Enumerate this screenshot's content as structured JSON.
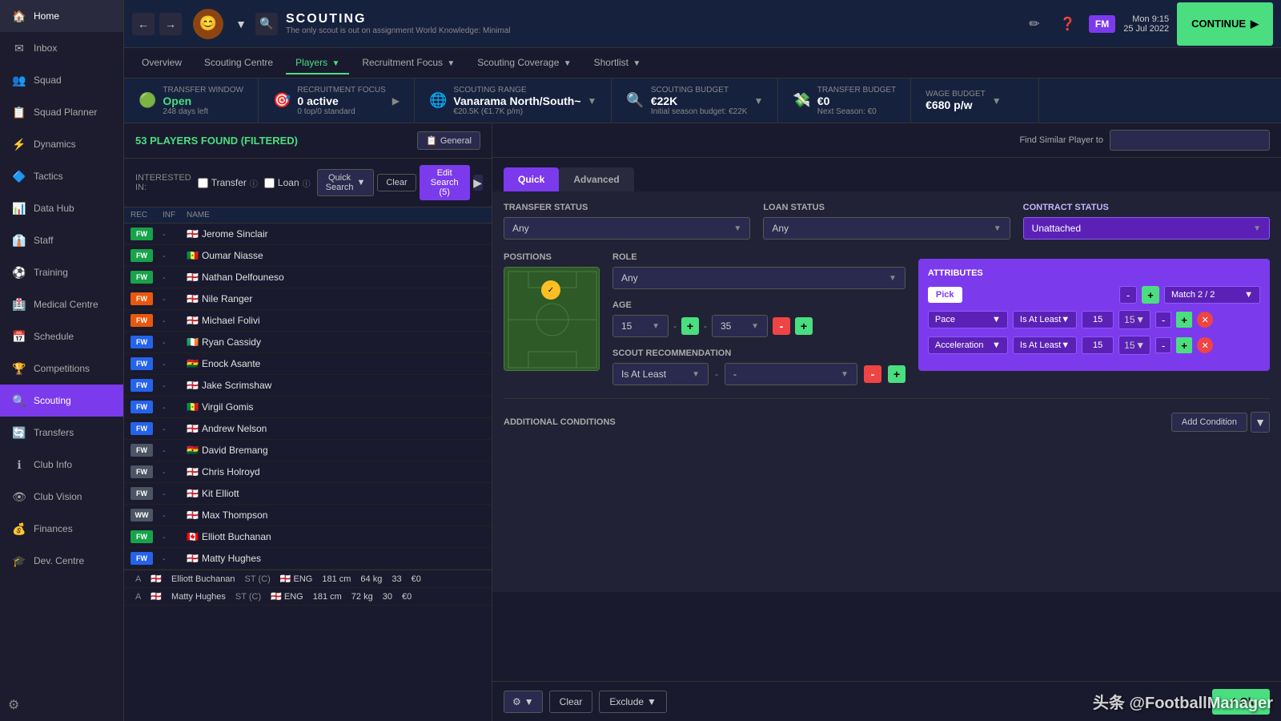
{
  "sidebar": {
    "items": [
      {
        "id": "home",
        "label": "Home",
        "icon": "🏠",
        "active": false
      },
      {
        "id": "inbox",
        "label": "Inbox",
        "icon": "✉",
        "active": false
      },
      {
        "id": "squad",
        "label": "Squad",
        "icon": "👥",
        "active": false
      },
      {
        "id": "squad-planner",
        "label": "Squad Planner",
        "icon": "📋",
        "active": false
      },
      {
        "id": "dynamics",
        "label": "Dynamics",
        "icon": "⚡",
        "active": false
      },
      {
        "id": "tactics",
        "label": "Tactics",
        "icon": "🔷",
        "active": false
      },
      {
        "id": "data-hub",
        "label": "Data Hub",
        "icon": "📊",
        "active": false
      },
      {
        "id": "staff",
        "label": "Staff",
        "icon": "👔",
        "active": false
      },
      {
        "id": "training",
        "label": "Training",
        "icon": "⚽",
        "active": false
      },
      {
        "id": "medical",
        "label": "Medical Centre",
        "icon": "🏥",
        "active": false
      },
      {
        "id": "schedule",
        "label": "Schedule",
        "icon": "📅",
        "active": false
      },
      {
        "id": "competitions",
        "label": "Competitions",
        "icon": "🏆",
        "active": false
      },
      {
        "id": "scouting",
        "label": "Scouting",
        "icon": "🔍",
        "active": true
      },
      {
        "id": "transfers",
        "label": "Transfers",
        "icon": "🔄",
        "active": false
      },
      {
        "id": "club-info",
        "label": "Club Info",
        "icon": "ℹ",
        "active": false
      },
      {
        "id": "club-vision",
        "label": "Club Vision",
        "icon": "👁",
        "active": false
      },
      {
        "id": "finances",
        "label": "Finances",
        "icon": "💰",
        "active": false
      },
      {
        "id": "dev-centre",
        "label": "Dev. Centre",
        "icon": "🎓",
        "active": false
      }
    ]
  },
  "topbar": {
    "title": "SCOUTING",
    "subtitle": "The only scout is out on assignment  World Knowledge: Minimal",
    "time": "Mon 9:15",
    "date": "25 Jul 2022",
    "fm_badge": "FM",
    "continue_label": "CONTINUE"
  },
  "subnav": {
    "items": [
      {
        "label": "Overview",
        "active": false
      },
      {
        "label": "Scouting Centre",
        "active": false
      },
      {
        "label": "Players",
        "active": true,
        "arrow": true
      },
      {
        "label": "Recruitment Focus",
        "active": false,
        "arrow": true
      },
      {
        "label": "Scouting Coverage",
        "active": false,
        "arrow": true
      },
      {
        "label": "Shortlist",
        "active": false,
        "arrow": true
      }
    ]
  },
  "statsbar": {
    "transfer_window": {
      "label": "TRANSFER WINDOW",
      "value": "Open",
      "sub": "248 days left",
      "icon": "🟢"
    },
    "recruitment_focus": {
      "label": "RECRUITMENT FOCUS",
      "value": "0 active",
      "sub": "0 top/0 standard",
      "icon": "🎯"
    },
    "scouting_range": {
      "label": "SCOUTING RANGE",
      "value": "Vanarama North/South~",
      "sub": "€20.5K (€1.7K p/m)",
      "icon": "🌐"
    },
    "scouting_budget": {
      "label": "SCOUTING BUDGET",
      "value": "€22K",
      "sub": "Initial season budget: €22K",
      "icon": "🔍"
    },
    "transfer_budget": {
      "label": "TRANSFER BUDGET",
      "value": "€0",
      "sub": "Next Season: €0",
      "icon": "💸"
    },
    "wage_budget": {
      "label": "WAGE BUDGET",
      "value": "€680 p/w"
    }
  },
  "players_panel": {
    "count_label": "53 PLAYERS FOUND (FILTERED)",
    "general_label": "General",
    "interested_in_label": "INTERESTED IN:",
    "transfer_label": "Transfer",
    "loan_label": "Loan",
    "search_btn_label": "Quick Search",
    "clear_label": "Clear",
    "edit_search_label": "Edit Search (5)",
    "columns": {
      "rec": "REC",
      "inf": "INF",
      "name": "NAME"
    },
    "players": [
      {
        "name": "Jerome Sinclair",
        "badge": "FW",
        "badge_type": "green",
        "flag": "🏴󠁧󠁢󠁥󠁮󠁧󠁿"
      },
      {
        "name": "Oumar Niasse",
        "badge": "FW",
        "badge_type": "green",
        "flag": "🇸🇳"
      },
      {
        "name": "Nathan Delfouneso",
        "badge": "FW",
        "badge_type": "green",
        "flag": "🏴󠁧󠁢󠁥󠁮󠁧󠁿"
      },
      {
        "name": "Nile Ranger",
        "badge": "FW",
        "badge_type": "orange",
        "flag": "🏴󠁧󠁢󠁥󠁮󠁧󠁿"
      },
      {
        "name": "Michael Folivi",
        "badge": "FW",
        "badge_type": "orange",
        "flag": "🏴󠁧󠁢󠁥󠁮󠁧󠁿"
      },
      {
        "name": "Ryan Cassidy",
        "badge": "FW",
        "badge_type": "blue",
        "flag": "🇮🇪"
      },
      {
        "name": "Enock Asante",
        "badge": "FW",
        "badge_type": "blue",
        "flag": "🇬🇭"
      },
      {
        "name": "Jake Scrimshaw",
        "badge": "FW",
        "badge_type": "blue",
        "flag": "🏴󠁧󠁢󠁥󠁮󠁧󠁿"
      },
      {
        "name": "Virgil Gomis",
        "badge": "FW",
        "badge_type": "blue",
        "flag": "🇸🇳"
      },
      {
        "name": "Andrew Nelson",
        "badge": "FW",
        "badge_type": "blue",
        "flag": "🏴󠁧󠁢󠁥󠁮󠁧󠁿"
      },
      {
        "name": "David Bremang",
        "badge": "FW",
        "badge_type": "gray",
        "flag": "🇬🇭"
      },
      {
        "name": "Chris Holroyd",
        "badge": "FW",
        "badge_type": "gray",
        "flag": "🏴󠁧󠁢󠁥󠁮󠁧󠁿"
      },
      {
        "name": "Kit Elliott",
        "badge": "FW",
        "badge_type": "gray",
        "flag": "🏴󠁧󠁢󠁥󠁮󠁧󠁿"
      },
      {
        "name": "Max Thompson",
        "badge": "WW",
        "badge_type": "gray",
        "flag": "🏴󠁧󠁢󠁥󠁮󠁧󠁿"
      },
      {
        "name": "Elliott Buchanan",
        "badge": "FW",
        "badge_type": "green",
        "flag": "🇨🇦"
      },
      {
        "name": "Matty Hughes",
        "badge": "FW",
        "badge_type": "blue",
        "flag": "🏴󠁧󠁢󠁥󠁮󠁧󠁿"
      }
    ],
    "bottom_rows": [
      {
        "name": "Elliott Buchanan",
        "pos": "ST (C)",
        "flag": "🏴󠁧󠁢󠁥󠁮󠁧󠁿",
        "nat": "ENG",
        "height": "181 cm",
        "weight": "64 kg",
        "age": "33",
        "value": "€0"
      },
      {
        "name": "Matty Hughes",
        "pos": "ST (C)",
        "flag": "🏴󠁧󠁢󠁥󠁮󠁧󠁿",
        "nat": "ENG",
        "height": "181 cm",
        "weight": "72 kg",
        "age": "30",
        "value": "€0"
      }
    ]
  },
  "search_panel": {
    "tabs": [
      {
        "label": "Quick",
        "active": true
      },
      {
        "label": "Advanced",
        "active": false
      }
    ],
    "find_similar_label": "Find Similar Player to",
    "transfer_status": {
      "label": "TRANSFER STATUS",
      "value": "Any"
    },
    "loan_status": {
      "label": "LOAN STATUS",
      "value": "Any"
    },
    "contract_status": {
      "label": "CONTRACT STATUS",
      "value": "Unattached"
    },
    "positions": {
      "label": "POSITIONS"
    },
    "role": {
      "label": "ROLE",
      "value": "Any"
    },
    "age": {
      "label": "AGE",
      "min": "15",
      "max": "35"
    },
    "attributes": {
      "label": "ATTRIBUTES",
      "pick_btn": "Pick",
      "match_label": "Match 2 / 2",
      "rows": [
        {
          "attr": "Pace",
          "condition": "Is At Least",
          "value": "15"
        },
        {
          "attr": "Acceleration",
          "condition": "Is At Least",
          "value": "15"
        }
      ]
    },
    "scout_recommendation": {
      "label": "SCOUT RECOMMENDATION",
      "condition": "Is At Least",
      "value": "-"
    },
    "additional_conditions": {
      "label": "ADDITIONAL CONDITIONS",
      "add_btn": "Add Condition"
    },
    "bottom_bar": {
      "settings_label": "⚙",
      "clear_label": "Clear",
      "exclude_label": "Exclude",
      "ok_label": "✓ Ok"
    }
  },
  "watermark": "头条 @FootballManager"
}
